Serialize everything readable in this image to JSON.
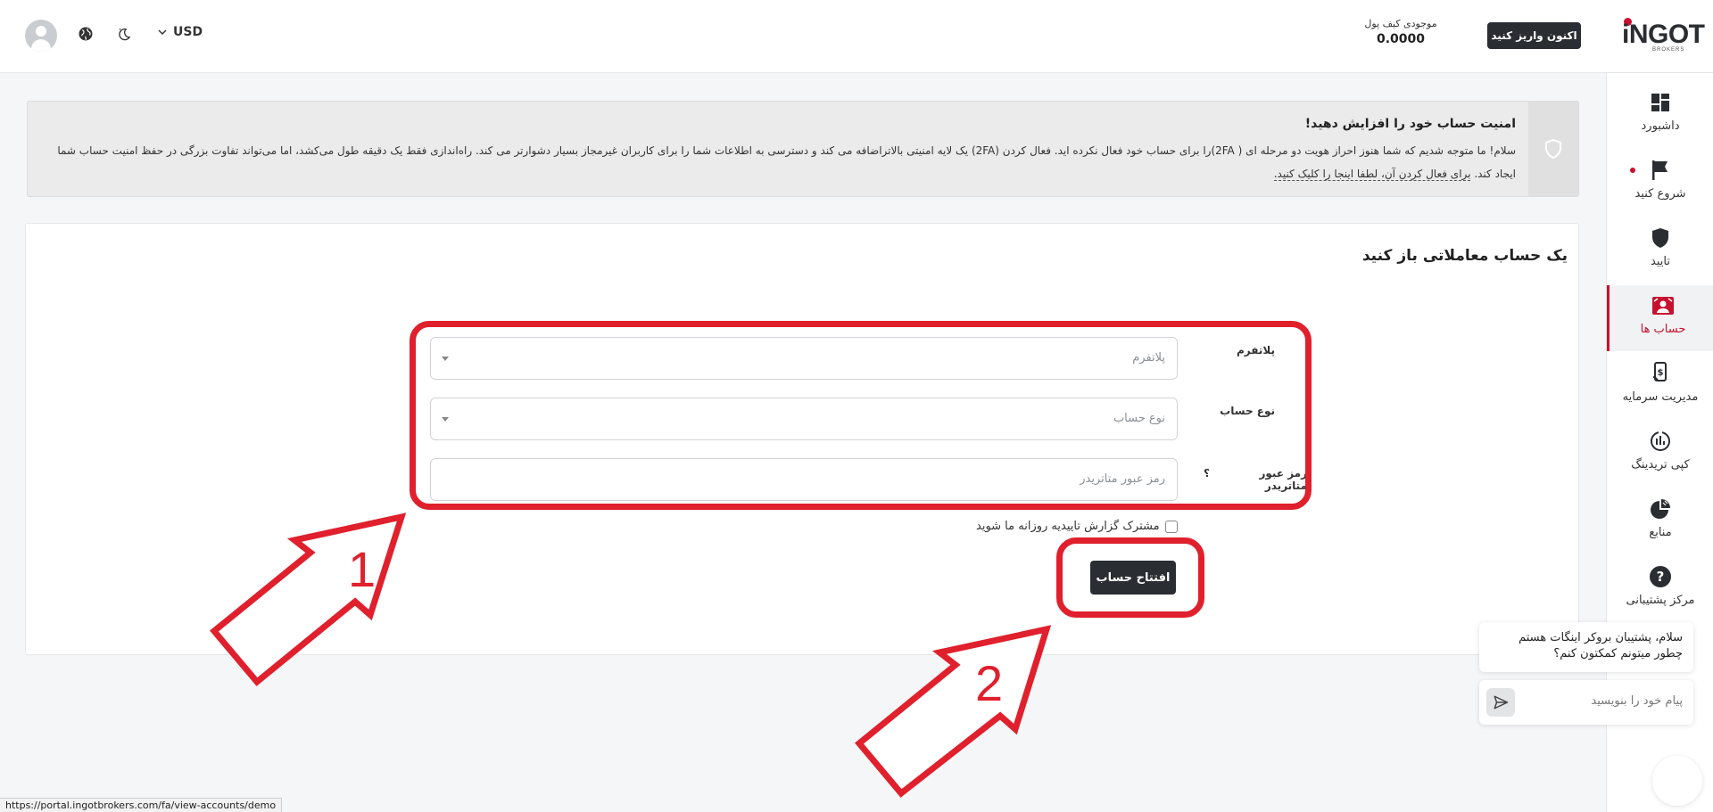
{
  "header": {
    "currency": "USD",
    "wallet_label": "موجودی کیف پول",
    "wallet_value": "0.0000",
    "deposit_button": "اکنون واریز کنید",
    "logo_text": "iNGOT",
    "logo_sub": "BROKERS"
  },
  "sidebar": {
    "items": [
      {
        "label": "داشبورد",
        "icon": "dashboard-icon"
      },
      {
        "label": "شروع کنید",
        "icon": "flag-icon"
      },
      {
        "label": "تایید",
        "icon": "shield-icon"
      },
      {
        "label": "حساب ها",
        "icon": "accounts-icon"
      },
      {
        "label": "مدیریت سرمایه",
        "icon": "money-icon"
      },
      {
        "label": "کپی تریدینگ",
        "icon": "copy-trading-icon"
      },
      {
        "label": "منابع",
        "icon": "pie-chart-icon"
      },
      {
        "label": "مرکز پشتیبانی",
        "icon": "help-icon"
      }
    ]
  },
  "alert": {
    "title": "امنیت حساب خود را افزایش دهید!",
    "text": "سلام! ما متوجه شدیم که شما هنوز احراز هویت دو مرحله ای ( 2FA)را برای حساب خود فعال نکرده اید. فعال کردن (2FA) یک لایه امنیتی بالاتراضافه می کند و دسترسی به اطلاعات شما را برای کاربران غیرمجاز بسیار دشوارتر می کند. راه‌اندازی فقط یک دقیقه طول می‌کشد، اما می‌تواند تفاوت بزرگی در حفظ امنیت حساب شما ایجاد کند.",
    "link": "برای فعال کردن آن، لطفا اینجا را کلیک کنید."
  },
  "form": {
    "title": "یک حساب معاملاتی باز کنید",
    "platform_label": "پلاتفرم",
    "platform_placeholder": "پلاتفرم",
    "account_type_label": "نوع حساب",
    "account_type_placeholder": "نوع حساب",
    "password_label": "رمز عبور متاتریدر",
    "password_placeholder": "رمز عبور متاتریدر",
    "help_mark": "؟",
    "subscribe_label": "مشترک گزارش تاییدیه روزانه ما شوید",
    "open_button": "افتتاح حساب"
  },
  "annotations": {
    "arrow1_label": "1",
    "arrow2_label": "2"
  },
  "chat": {
    "message": "سلام، پشتیبان بروکر اینگات هستم چطور میتونم کمکتون کنم؟",
    "input_placeholder": "پیام خود را بنویسید"
  },
  "status_url": "https://portal.ingotbrokers.com/fa/view-accounts/demo"
}
